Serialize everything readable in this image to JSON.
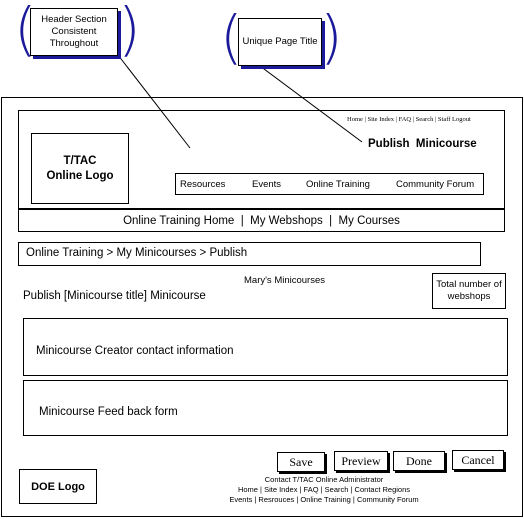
{
  "callouts": {
    "header": "Header Section Consistent Throughout",
    "title": "Unique Page Title"
  },
  "header": {
    "top_links": [
      "Home",
      "Site Index",
      "FAQ",
      "Search",
      "Staff Logout"
    ],
    "logo": "T/TAC Online Logo",
    "page_title": "Publish  Minicourse",
    "nav_items": [
      "Resources",
      "Events",
      "Online Training",
      "Community Forum"
    ]
  },
  "subnav": {
    "items": [
      "Online Training Home",
      "My Webshops",
      "My Courses"
    ]
  },
  "breadcrumb": "Online Training > My Minicourses > Publish",
  "main": {
    "owner_label": "Mary's Minicourses",
    "publish_title": "Publish [Minicourse title] Minicourse",
    "total_label": "Total number of webshops",
    "contact_section": "Minicourse Creator contact information",
    "feedback_section": "Minicourse Feed back form"
  },
  "actions": {
    "save": "Save",
    "preview": "Preview",
    "done": "Done",
    "cancel": "Cancel"
  },
  "footer": {
    "logo": "DOE Logo",
    "contact": "Contact T/TAC Online Administrator",
    "links_line1": "Home | Site Index | FAQ | Search | Contact Regions",
    "links_line2": "Events | Resrouces | Online Training | Community Forum"
  }
}
